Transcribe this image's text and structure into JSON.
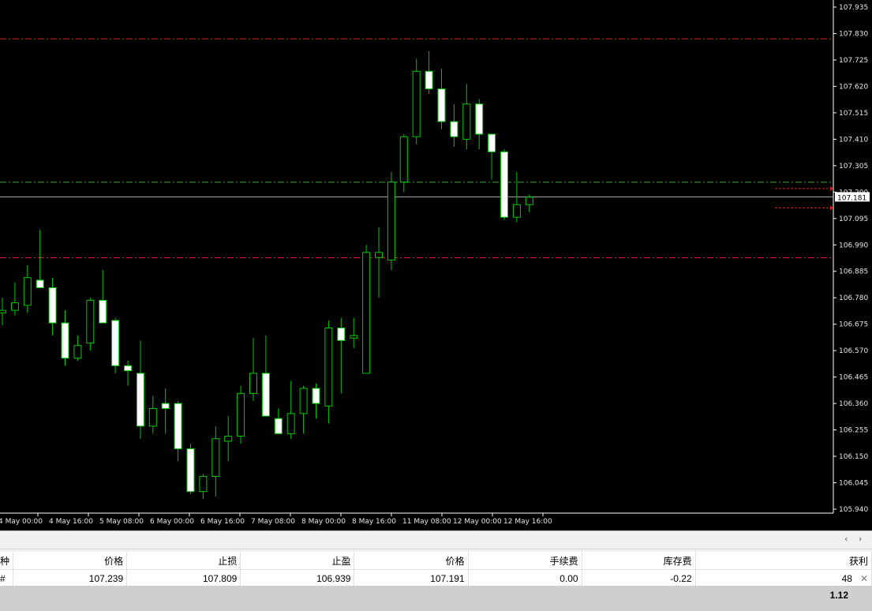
{
  "chart_data": {
    "type": "candlestick",
    "y_ticks": [
      "107.935",
      "107.830",
      "107.725",
      "107.620",
      "107.515",
      "107.410",
      "107.305",
      "107.200",
      "107.095",
      "106.990",
      "106.885",
      "106.780",
      "106.675",
      "106.570",
      "106.465",
      "106.360",
      "106.255",
      "106.150",
      "106.045",
      "105.940"
    ],
    "ylim": [
      105.94,
      107.935
    ],
    "x_labels": [
      "4 May 00:00",
      "4 May 16:00",
      "5 May 08:00",
      "6 May 00:00",
      "6 May 16:00",
      "7 May 08:00",
      "8 May 00:00",
      "8 May 16:00",
      "11 May 08:00",
      "12 May 00:00",
      "12 May 16:00"
    ],
    "current_price": "107.181",
    "current_price_value": 107.181,
    "levels": [
      {
        "name": "stop-loss-line",
        "value": 107.809,
        "style": "red-dashdot"
      },
      {
        "name": "take-profit-line",
        "value": 106.939,
        "style": "red-dashdot"
      },
      {
        "name": "open-price-line",
        "value": 107.239,
        "style": "green-dashdot"
      }
    ],
    "candles": [
      {
        "o": 106.72,
        "h": 106.78,
        "l": 106.67,
        "c": 106.73
      },
      {
        "o": 106.73,
        "h": 106.84,
        "l": 106.71,
        "c": 106.76
      },
      {
        "o": 106.75,
        "h": 106.91,
        "l": 106.72,
        "c": 106.86
      },
      {
        "o": 106.85,
        "h": 107.05,
        "l": 106.82,
        "c": 106.82
      },
      {
        "o": 106.82,
        "h": 106.86,
        "l": 106.63,
        "c": 106.68
      },
      {
        "o": 106.68,
        "h": 106.73,
        "l": 106.51,
        "c": 106.54
      },
      {
        "o": 106.54,
        "h": 106.63,
        "l": 106.53,
        "c": 106.59
      },
      {
        "o": 106.6,
        "h": 106.78,
        "l": 106.57,
        "c": 106.77
      },
      {
        "o": 106.77,
        "h": 106.89,
        "l": 106.68,
        "c": 106.68
      },
      {
        "o": 106.69,
        "h": 106.7,
        "l": 106.48,
        "c": 106.51
      },
      {
        "o": 106.51,
        "h": 106.53,
        "l": 106.43,
        "c": 106.49
      },
      {
        "o": 106.48,
        "h": 106.61,
        "l": 106.22,
        "c": 106.27
      },
      {
        "o": 106.27,
        "h": 106.39,
        "l": 106.24,
        "c": 106.34
      },
      {
        "o": 106.36,
        "h": 106.42,
        "l": 106.24,
        "c": 106.34
      },
      {
        "o": 106.36,
        "h": 106.37,
        "l": 106.13,
        "c": 106.18
      },
      {
        "o": 106.18,
        "h": 106.2,
        "l": 106.0,
        "c": 106.01
      },
      {
        "o": 106.01,
        "h": 106.08,
        "l": 105.98,
        "c": 106.07
      },
      {
        "o": 106.07,
        "h": 106.27,
        "l": 105.99,
        "c": 106.22
      },
      {
        "o": 106.21,
        "h": 106.31,
        "l": 106.13,
        "c": 106.23
      },
      {
        "o": 106.23,
        "h": 106.43,
        "l": 106.2,
        "c": 106.4
      },
      {
        "o": 106.4,
        "h": 106.62,
        "l": 106.37,
        "c": 106.48
      },
      {
        "o": 106.48,
        "h": 106.63,
        "l": 106.31,
        "c": 106.31
      },
      {
        "o": 106.3,
        "h": 106.34,
        "l": 106.24,
        "c": 106.24
      },
      {
        "o": 106.24,
        "h": 106.45,
        "l": 106.22,
        "c": 106.32
      },
      {
        "o": 106.32,
        "h": 106.43,
        "l": 106.24,
        "c": 106.42
      },
      {
        "o": 106.42,
        "h": 106.44,
        "l": 106.3,
        "c": 106.36
      },
      {
        "o": 106.35,
        "h": 106.69,
        "l": 106.28,
        "c": 106.66
      },
      {
        "o": 106.66,
        "h": 106.7,
        "l": 106.4,
        "c": 106.61
      },
      {
        "o": 106.62,
        "h": 106.7,
        "l": 106.58,
        "c": 106.63
      },
      {
        "o": 106.48,
        "h": 106.99,
        "l": 106.48,
        "c": 106.96
      },
      {
        "o": 106.94,
        "h": 107.06,
        "l": 106.78,
        "c": 106.96
      },
      {
        "o": 106.93,
        "h": 107.28,
        "l": 106.89,
        "c": 107.24
      },
      {
        "o": 107.24,
        "h": 107.43,
        "l": 107.2,
        "c": 107.42
      },
      {
        "o": 107.42,
        "h": 107.73,
        "l": 107.39,
        "c": 107.68
      },
      {
        "o": 107.68,
        "h": 107.76,
        "l": 107.59,
        "c": 107.61
      },
      {
        "o": 107.61,
        "h": 107.69,
        "l": 107.45,
        "c": 107.48
      },
      {
        "o": 107.48,
        "h": 107.55,
        "l": 107.38,
        "c": 107.42
      },
      {
        "o": 107.41,
        "h": 107.63,
        "l": 107.37,
        "c": 107.55
      },
      {
        "o": 107.55,
        "h": 107.57,
        "l": 107.37,
        "c": 107.43
      },
      {
        "o": 107.43,
        "h": 107.43,
        "l": 107.25,
        "c": 107.36
      },
      {
        "o": 107.36,
        "h": 107.37,
        "l": 107.09,
        "c": 107.1
      },
      {
        "o": 107.1,
        "h": 107.28,
        "l": 107.08,
        "c": 107.15
      },
      {
        "o": 107.15,
        "h": 107.19,
        "l": 107.12,
        "c": 107.18
      }
    ]
  },
  "terminal": {
    "headers": [
      "种",
      "价格",
      "止损",
      "止盈",
      "价格",
      "手续费",
      "库存费",
      "获利"
    ],
    "row": [
      "#",
      "107.239",
      "107.809",
      "106.939",
      "107.191",
      "0.00",
      "-0.22",
      "48"
    ],
    "close_glyph": "✕",
    "summary_value": "1.12",
    "scroll_left": "‹",
    "scroll_right": "›"
  },
  "colors": {
    "background": "#000000",
    "candle_bull": "#ffffff",
    "candle_outline": "#00c800",
    "wick": "#00c800",
    "level_red": "#d81f1f",
    "level_green": "#32a832",
    "grid_text": "#e6e6e6"
  }
}
